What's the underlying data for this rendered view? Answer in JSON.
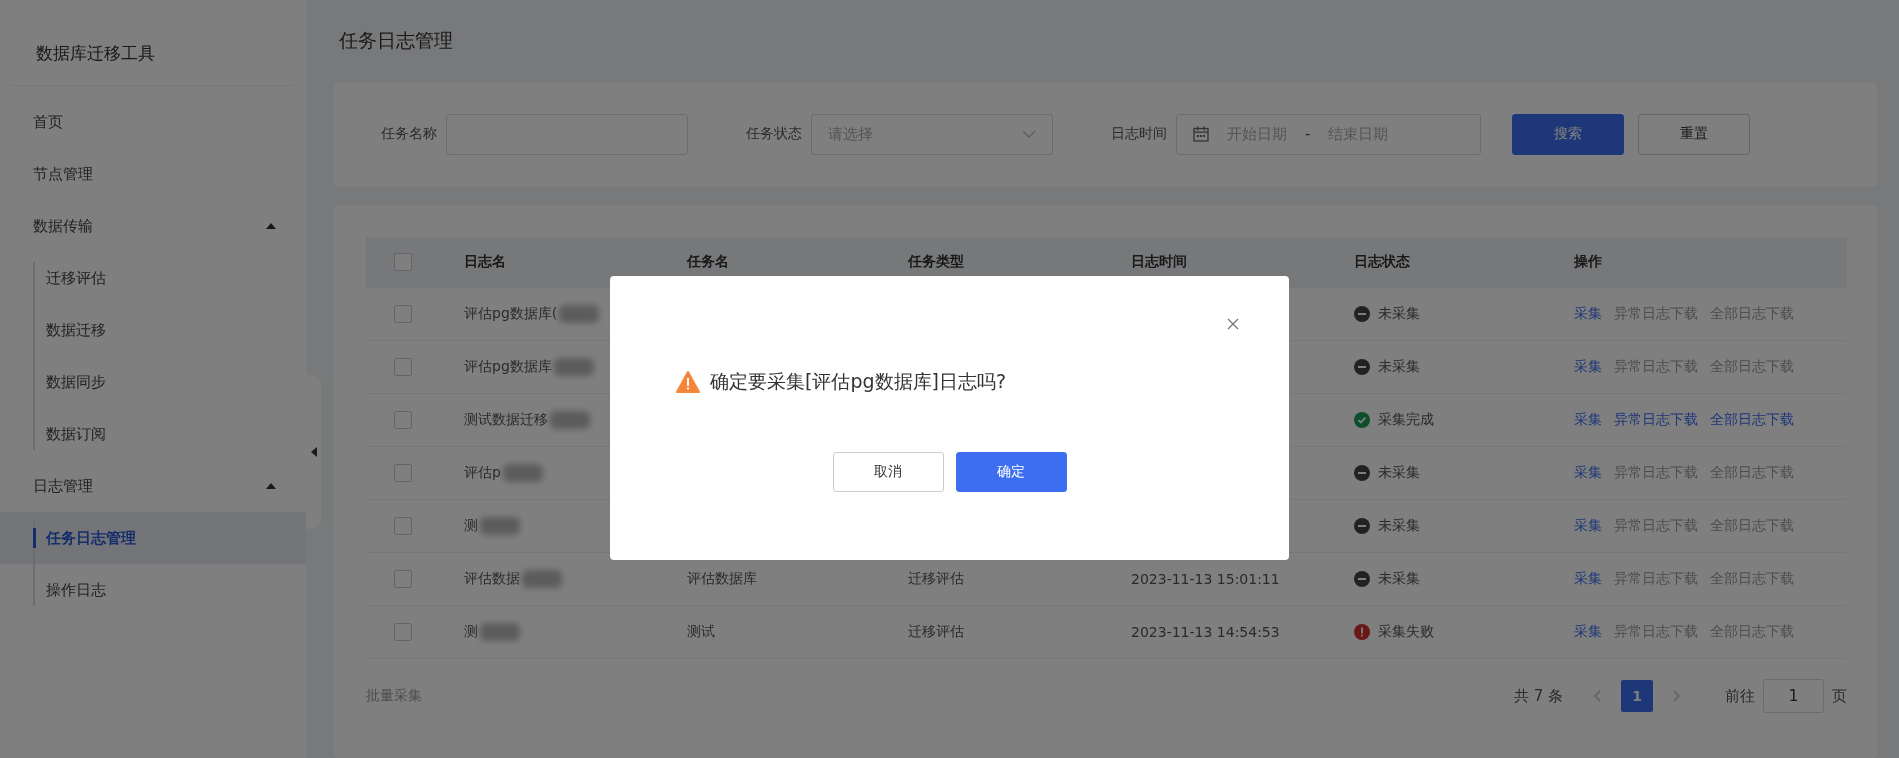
{
  "sidebar": {
    "title": "数据库迁移工具",
    "items": [
      {
        "label": "首页",
        "selected": false
      },
      {
        "label": "节点管理",
        "selected": false
      },
      {
        "label": "数据传输",
        "selected": false,
        "expanded": true,
        "children": [
          {
            "label": "迁移评估",
            "selected": false
          },
          {
            "label": "数据迁移",
            "selected": false
          },
          {
            "label": "数据同步",
            "selected": false
          },
          {
            "label": "数据订阅",
            "selected": false
          }
        ]
      },
      {
        "label": "日志管理",
        "selected": false,
        "expanded": true,
        "children": [
          {
            "label": "任务日志管理",
            "selected": true
          },
          {
            "label": "操作日志",
            "selected": false
          }
        ]
      }
    ]
  },
  "page_title": "任务日志管理",
  "filters": [
    {
      "kind": "text",
      "label": "任务名称"
    },
    {
      "kind": "select",
      "label": "任务状态",
      "placeholder": "请选择"
    },
    {
      "kind": "daterange",
      "label": "日志时间",
      "start_placeholder": "开始日期",
      "separator": "-",
      "end_placeholder": "结束日期"
    }
  ],
  "filter_buttons": [
    {
      "label": "搜索",
      "kind": "primary"
    },
    {
      "label": "重置",
      "kind": "default"
    }
  ],
  "table": {
    "header_checked": false,
    "columns": [
      "日志名",
      "任务名",
      "任务类型",
      "日志时间",
      "日志状态",
      "操作"
    ],
    "rows": [
      {
        "checked": false,
        "name": "评估pg数据库(",
        "redacted": true,
        "status": {
          "kind": "pending",
          "label": "未采集"
        },
        "actions": [
          {
            "label": "采集",
            "disabled": false
          },
          {
            "label": "异常日志下载",
            "disabled": true
          },
          {
            "label": "全部日志下载",
            "disabled": true
          }
        ]
      },
      {
        "checked": false,
        "name": "评估pg数据库",
        "redacted": true,
        "status": {
          "kind": "pending",
          "label": "未采集"
        },
        "actions": [
          {
            "label": "采集",
            "disabled": false
          },
          {
            "label": "异常日志下载",
            "disabled": true
          },
          {
            "label": "全部日志下载",
            "disabled": true
          }
        ]
      },
      {
        "checked": false,
        "name": "测试数据迁移",
        "redacted": true,
        "status": {
          "kind": "done",
          "label": "采集完成"
        },
        "actions": [
          {
            "label": "采集",
            "disabled": false
          },
          {
            "label": "异常日志下载",
            "disabled": false
          },
          {
            "label": "全部日志下载",
            "disabled": false
          }
        ]
      },
      {
        "checked": false,
        "name": "评估p",
        "redacted": true,
        "status": {
          "kind": "pending",
          "label": "未采集"
        },
        "actions": [
          {
            "label": "采集",
            "disabled": false
          },
          {
            "label": "异常日志下载",
            "disabled": true
          },
          {
            "label": "全部日志下载",
            "disabled": true
          }
        ]
      },
      {
        "checked": false,
        "name": "测",
        "redacted": true,
        "status": {
          "kind": "pending",
          "label": "未采集"
        },
        "actions": [
          {
            "label": "采集",
            "disabled": false
          },
          {
            "label": "异常日志下载",
            "disabled": true
          },
          {
            "label": "全部日志下载",
            "disabled": true
          }
        ]
      },
      {
        "checked": false,
        "name": "评估数据",
        "redacted": true,
        "task": "评估数据库",
        "type": "迁移评估",
        "time": "2023-11-13 15:01:11",
        "status": {
          "kind": "pending",
          "label": "未采集"
        },
        "actions": [
          {
            "label": "采集",
            "disabled": false
          },
          {
            "label": "异常日志下载",
            "disabled": true
          },
          {
            "label": "全部日志下载",
            "disabled": true
          }
        ]
      },
      {
        "checked": false,
        "name": "测",
        "redacted": true,
        "task": "测试",
        "type": "迁移评估",
        "time": "2023-11-13 14:54:53",
        "status": {
          "kind": "failed",
          "label": "采集失败"
        },
        "actions": [
          {
            "label": "采集",
            "disabled": false
          },
          {
            "label": "异常日志下载",
            "disabled": true
          },
          {
            "label": "全部日志下载",
            "disabled": true
          }
        ]
      }
    ]
  },
  "footer": {
    "batch_action": {
      "label": "批量采集",
      "disabled": true
    },
    "total": "共 7 条",
    "pages": [
      {
        "label": "1",
        "selected": true
      }
    ],
    "goto_label": "前往",
    "goto_value": "1",
    "goto_suffix": "页"
  },
  "dialog": {
    "message": "确定要采集[评估pg数据库]日志吗?",
    "buttons": [
      {
        "label": "取消",
        "kind": "default"
      },
      {
        "label": "确定",
        "kind": "primary"
      }
    ]
  }
}
